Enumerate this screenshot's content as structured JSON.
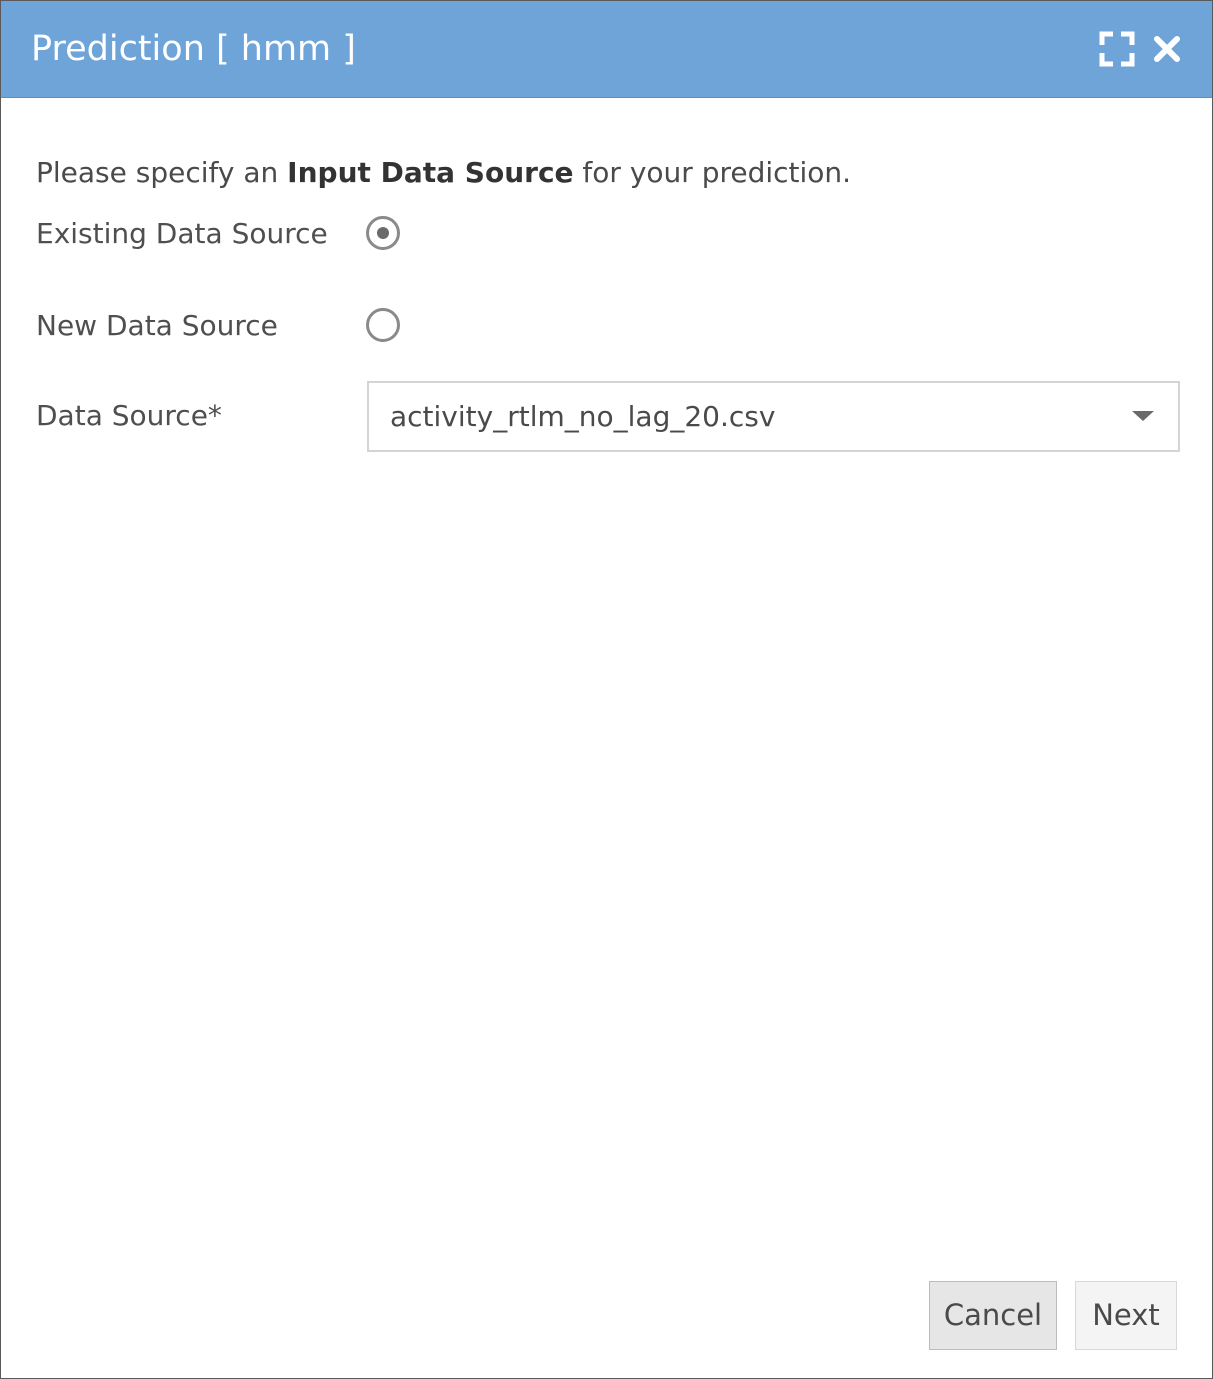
{
  "dialog": {
    "title": "Prediction [ hmm ]",
    "icons": {
      "maximize": "maximize-icon",
      "close": "close-icon"
    },
    "header_color": "#6ea4d8"
  },
  "form": {
    "prompt_before": "Please specify an ",
    "prompt_bold": "Input Data Source",
    "prompt_after": " for your prediction.",
    "options": [
      {
        "label": "Existing Data Source",
        "selected": true
      },
      {
        "label": "New Data Source",
        "selected": false
      }
    ],
    "data_source_label": "Data Source*",
    "data_source_value": "activity_rtlm_no_lag_20.csv"
  },
  "footer": {
    "cancel_label": "Cancel",
    "next_label": "Next"
  }
}
